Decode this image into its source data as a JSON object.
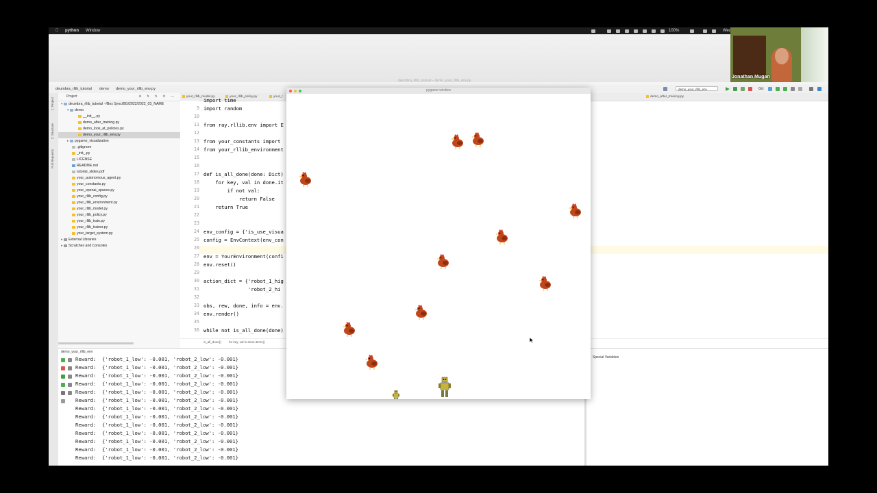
{
  "menubar": {
    "apple": "",
    "app": "python",
    "menu": "Window",
    "battery": "100%",
    "clock": "Wed"
  },
  "ide": {
    "window_title": "deumbra_rllib_tutorial – demo_your_rllib_env.py",
    "crumbs": [
      "deumbra_rllib_tutorial",
      "demo",
      "demo_your_rllib_env.py"
    ],
    "run_config": "demo_your_rllib_env",
    "git_label": "Git:",
    "vertical_tabs": [
      "1: Project",
      "2: Structure",
      "Pull Requests"
    ]
  },
  "project": {
    "header": "Project",
    "tree": [
      {
        "label": "deumbra_rllib_tutorial  ~/Box Sync/BG/2022/2022_03_NAME",
        "indent": 0,
        "type": "folder",
        "open": true
      },
      {
        "label": "demo",
        "indent": 1,
        "type": "folder",
        "open": true
      },
      {
        "label": "__init__.py",
        "indent": 2,
        "type": "py"
      },
      {
        "label": "demo_after_training.py",
        "indent": 2,
        "type": "py"
      },
      {
        "label": "demo_look_at_policies.py",
        "indent": 2,
        "type": "py"
      },
      {
        "label": "demo_your_rllib_env.py",
        "indent": 2,
        "type": "py",
        "selected": true
      },
      {
        "label": "pygame_visualization",
        "indent": 1,
        "type": "folder"
      },
      {
        "label": ".gitignore",
        "indent": 1,
        "type": "file"
      },
      {
        "label": "_init_.py",
        "indent": 1,
        "type": "py"
      },
      {
        "label": "LICENSE",
        "indent": 1,
        "type": "file"
      },
      {
        "label": "README.md",
        "indent": 1,
        "type": "md"
      },
      {
        "label": "tutorial_slides.pdf",
        "indent": 1,
        "type": "file"
      },
      {
        "label": "your_autonomous_agent.py",
        "indent": 1,
        "type": "py"
      },
      {
        "label": "your_constants.py",
        "indent": 1,
        "type": "py"
      },
      {
        "label": "your_openai_spaces.py",
        "indent": 1,
        "type": "py"
      },
      {
        "label": "your_rllib_config.py",
        "indent": 1,
        "type": "py"
      },
      {
        "label": "your_rllib_environment.py",
        "indent": 1,
        "type": "py"
      },
      {
        "label": "your_rllib_model.py",
        "indent": 1,
        "type": "py"
      },
      {
        "label": "your_rllib_policy.py",
        "indent": 1,
        "type": "py"
      },
      {
        "label": "your_rllib_train.py",
        "indent": 1,
        "type": "py"
      },
      {
        "label": "your_rllib_trainer.py",
        "indent": 1,
        "type": "py"
      },
      {
        "label": "your_target_system.py",
        "indent": 1,
        "type": "py"
      },
      {
        "label": "External Libraries",
        "indent": 0,
        "type": "lib"
      },
      {
        "label": "Scratches and Consoles",
        "indent": 0,
        "type": "lib"
      }
    ]
  },
  "editor": {
    "tabs": [
      "your_rllib_model.py",
      "your_rllib_policy.py",
      "your_r",
      "demo_after_training.py"
    ],
    "lines": [
      {
        "n": "",
        "code": "import time"
      },
      {
        "n": "9",
        "code": "import random"
      },
      {
        "n": "10",
        "code": ""
      },
      {
        "n": "11",
        "code": "from ray.rllib.env import E"
      },
      {
        "n": "12",
        "code": ""
      },
      {
        "n": "13",
        "code": "from your_constants import"
      },
      {
        "n": "14",
        "code": "from your_rllib_environment"
      },
      {
        "n": "15",
        "code": ""
      },
      {
        "n": "16",
        "code": ""
      },
      {
        "n": "17",
        "code": "def is_all_done(done: Dict)"
      },
      {
        "n": "18",
        "code": "    for key, val in done.it"
      },
      {
        "n": "19",
        "code": "        if not val:"
      },
      {
        "n": "20",
        "code": "            return False"
      },
      {
        "n": "21",
        "code": "    return True"
      },
      {
        "n": "22",
        "code": ""
      },
      {
        "n": "23",
        "code": ""
      },
      {
        "n": "24",
        "code": "env_config = {'is_use_visua"
      },
      {
        "n": "25",
        "code": "config = EnvContext(env_con"
      },
      {
        "n": "26",
        "code": ""
      },
      {
        "n": "27",
        "code": "env = YourEnvironment(confi"
      },
      {
        "n": "28",
        "code": "env.reset()"
      },
      {
        "n": "29",
        "code": ""
      },
      {
        "n": "30",
        "code": "action_dict = {'robot_1_hig"
      },
      {
        "n": "31",
        "code": "               'robot_2_hi"
      },
      {
        "n": "32",
        "code": ""
      },
      {
        "n": "33",
        "code": "obs, rew, done, info = env."
      },
      {
        "n": "34",
        "code": "env.render()"
      },
      {
        "n": "35",
        "code": ""
      },
      {
        "n": "36",
        "code": "while not is_all_done(done)"
      }
    ],
    "breadcrumb": [
      "is_all_done()",
      "for key, val in done.items()"
    ]
  },
  "run": {
    "tab": "demo_your_rllib_env",
    "special": "Special Variables",
    "lines": [
      "Reward:  {'robot_1_low': -0.001, 'robot_2_low': -0.001}",
      "Reward:  {'robot_1_low': -0.001, 'robot_2_low': -0.001}",
      "Reward:  {'robot_1_low': -0.001, 'robot_2_low': -0.001}",
      "Reward:  {'robot_1_low': -0.001, 'robot_2_low': -0.001}",
      "Reward:  {'robot_1_low': -0.001, 'robot_2_low': -0.001}",
      "Reward:  {'robot_1_low': -0.001, 'robot_2_low': -0.001}",
      "Reward:  {'robot_1_low': -0.001, 'robot_2_low': -0.001}",
      "Reward:  {'robot_1_low': -0.001, 'robot_2_low': -0.001}",
      "Reward:  {'robot_1_low': -0.001, 'robot_2_low': -0.001}",
      "Reward:  {'robot_1_low': -0.001, 'robot_2_low': -0.001}",
      "Reward:  {'robot_1_low': -0.001, 'robot_2_low': -0.001}",
      "Reward:  {'robot_1_low': -0.001, 'robot_2_low': -0.001}",
      "Reward:  {'robot_1_low': -0.001, 'robot_2_low': -0.001}"
    ]
  },
  "pygame": {
    "title": "pygame window"
  },
  "webcam": {
    "name": "Jonathan Mugan"
  },
  "colors": {
    "accent": "#0033b3",
    "hen_body": "#c0471b",
    "hen_comb": "#e01e1e",
    "robot": "#c8b43a"
  }
}
